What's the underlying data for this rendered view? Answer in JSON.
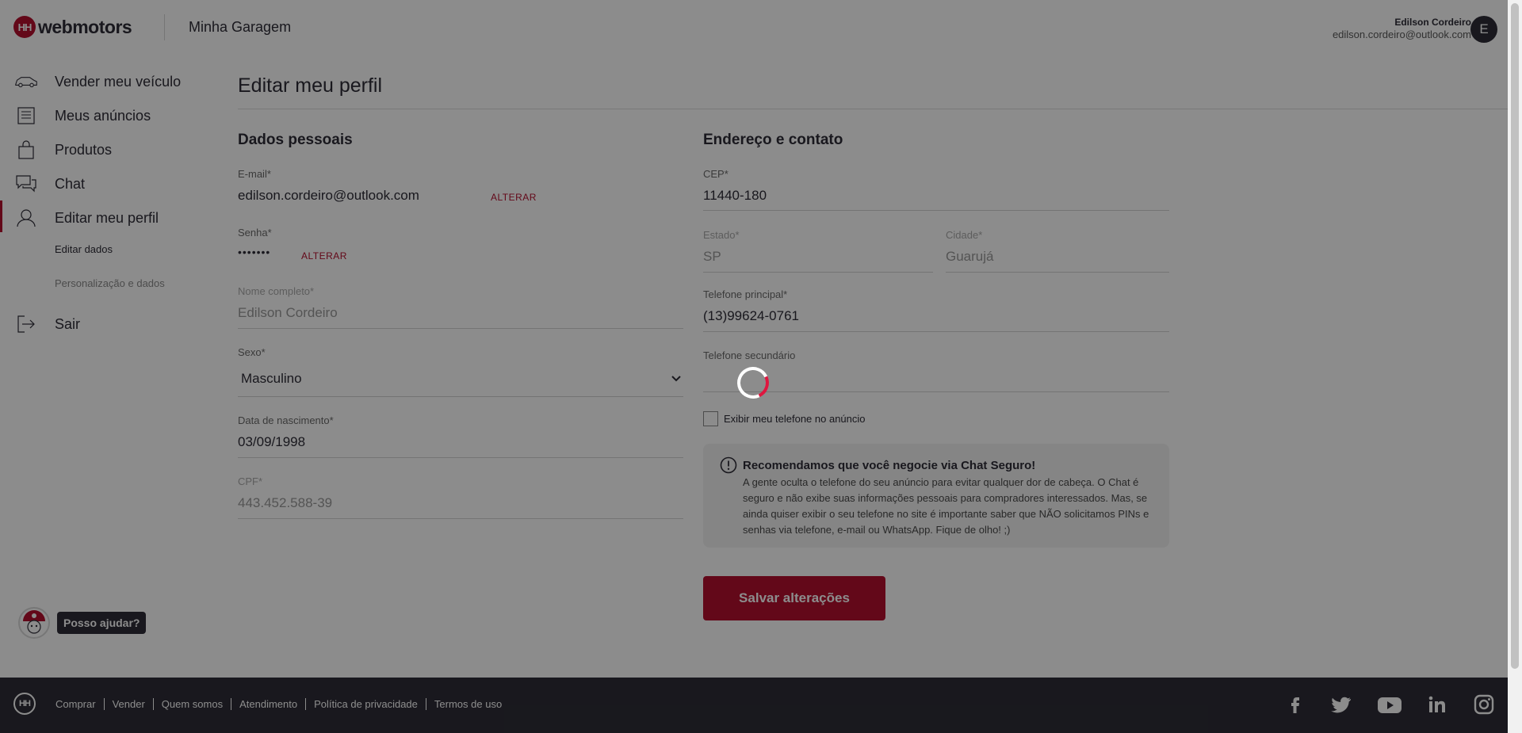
{
  "header": {
    "logo_badge": "HH",
    "logo_text": "webmotors",
    "title": "Minha Garagem",
    "user_name": "Edilson Cordeiro",
    "user_email": "edilson.cordeiro@outlook.com",
    "avatar_initial": "E"
  },
  "sidebar": {
    "items": [
      {
        "label": "Vender meu veículo",
        "icon": "car-icon"
      },
      {
        "label": "Meus anúncios",
        "icon": "listing-icon"
      },
      {
        "label": "Produtos",
        "icon": "bag-icon"
      },
      {
        "label": "Chat",
        "icon": "chat-icon"
      },
      {
        "label": "Editar meu perfil",
        "icon": "user-icon"
      },
      {
        "label": "Sair",
        "icon": "exit-icon"
      }
    ],
    "sub_items": [
      "Editar dados",
      "Personalização e dados"
    ]
  },
  "main": {
    "page_title": "Editar meu perfil",
    "personal": {
      "title": "Dados pessoais",
      "email_label": "E-mail*",
      "email_value": "edilson.cordeiro@outlook.com",
      "email_action": "ALTERAR",
      "password_label": "Senha*",
      "password_value": "•••••••",
      "password_action": "ALTERAR",
      "name_label": "Nome completo*",
      "name_value": "Edilson Cordeiro",
      "sex_label": "Sexo*",
      "sex_value": "Masculino",
      "birth_label": "Data de nascimento*",
      "birth_value": "03/09/1998",
      "cpf_label": "CPF*",
      "cpf_value": "443.452.588-39"
    },
    "address": {
      "title": "Endereço e contato",
      "cep_label": "CEP*",
      "cep_value": "11440-180",
      "state_label": "Estado*",
      "state_value": "SP",
      "city_label": "Cidade*",
      "city_value": "Guarujá",
      "phone_label": "Telefone principal*",
      "phone_value": "(13)99624-0761",
      "phone2_label": "Telefone secundário",
      "phone2_value": "",
      "show_phone_label": "Exibir meu telefone no anúncio"
    },
    "notice": {
      "title": "Recomendamos que você negocie via Chat Seguro!",
      "text": "A gente oculta o telefone do seu anúncio para evitar qualquer dor de cabeça. O Chat é seguro e não exibe suas informações pessoais para compradores interessados. Mas, se ainda quiser exibir o seu telefone no site é importante saber que NÃO solicitamos PINs e senhas via telefone, e-mail ou WhatsApp. Fique de olho! ;)"
    },
    "save_label": "Salvar alterações"
  },
  "help": {
    "label": "Posso ajudar?"
  },
  "footer": {
    "logo": "HH",
    "links": [
      "Comprar",
      "Vender",
      "Quem somos",
      "Atendimento",
      "Política de privacidade",
      "Termos de uso"
    ],
    "social": [
      "facebook-icon",
      "twitter-icon",
      "youtube-icon",
      "linkedin-icon",
      "instagram-icon"
    ]
  },
  "colors": {
    "brand": "#b5102f",
    "text": "#2e2d37",
    "overlay": "rgba(0,0,0,0.45)"
  }
}
